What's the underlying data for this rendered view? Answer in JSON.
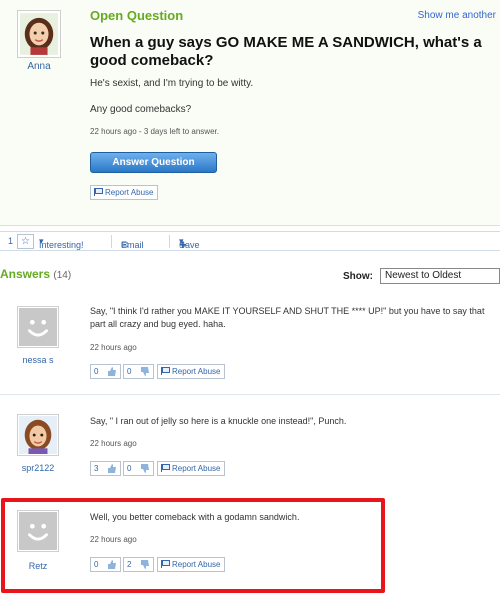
{
  "question": {
    "type_label": "Open Question",
    "show_another": "Show me another",
    "title": "When a guy says GO MAKE ME A SANDWICH, what's a good comeback?",
    "body_lines": [
      "He's sexist, and I'm trying to be witty.",
      "Any good comebacks?"
    ],
    "meta": "22 hours ago - 3 days left to answer.",
    "answer_button": "Answer Question",
    "report_label": "Report Abuse",
    "asker": {
      "name": "Anna",
      "avatar_icon": "female-avatar-icon"
    }
  },
  "action_bar": {
    "interesting_count": "1",
    "interesting_label": "Interesting!",
    "email_label": "Email",
    "save_label": "Save"
  },
  "answers_section": {
    "title": "Answers",
    "count": "(14)",
    "show_label": "Show:",
    "sort_value": "Newest to Oldest"
  },
  "answers": [
    {
      "user": "nessa s",
      "avatar_icon": "default-avatar-icon",
      "text": "Say, \"I think I'd rather you MAKE IT YOURSELF AND SHUT THE **** UP!\" but you have to say that part all crazy and bug eyed. haha.",
      "time": "22 hours ago",
      "thumbs_up": "0",
      "thumbs_down": "0",
      "report": "Report Abuse"
    },
    {
      "user": "spr2122",
      "avatar_icon": "female-avatar-icon",
      "text": "Say, \" I ran out of jelly so here is a knuckle one instead!\", Punch.",
      "time": "22 hours ago",
      "thumbs_up": "3",
      "thumbs_down": "0",
      "report": "Report Abuse"
    },
    {
      "user": "Retz",
      "avatar_icon": "default-avatar-icon",
      "text": "Well, you better comeback with a godamn sandwich.",
      "time": "22 hours ago",
      "thumbs_up": "0",
      "thumbs_down": "2",
      "report": "Report Abuse"
    }
  ],
  "colors": {
    "accent_green": "#66aa22",
    "link_blue": "#3366aa",
    "highlight_red": "#e8151b",
    "button_blue": "#2b78c8"
  }
}
